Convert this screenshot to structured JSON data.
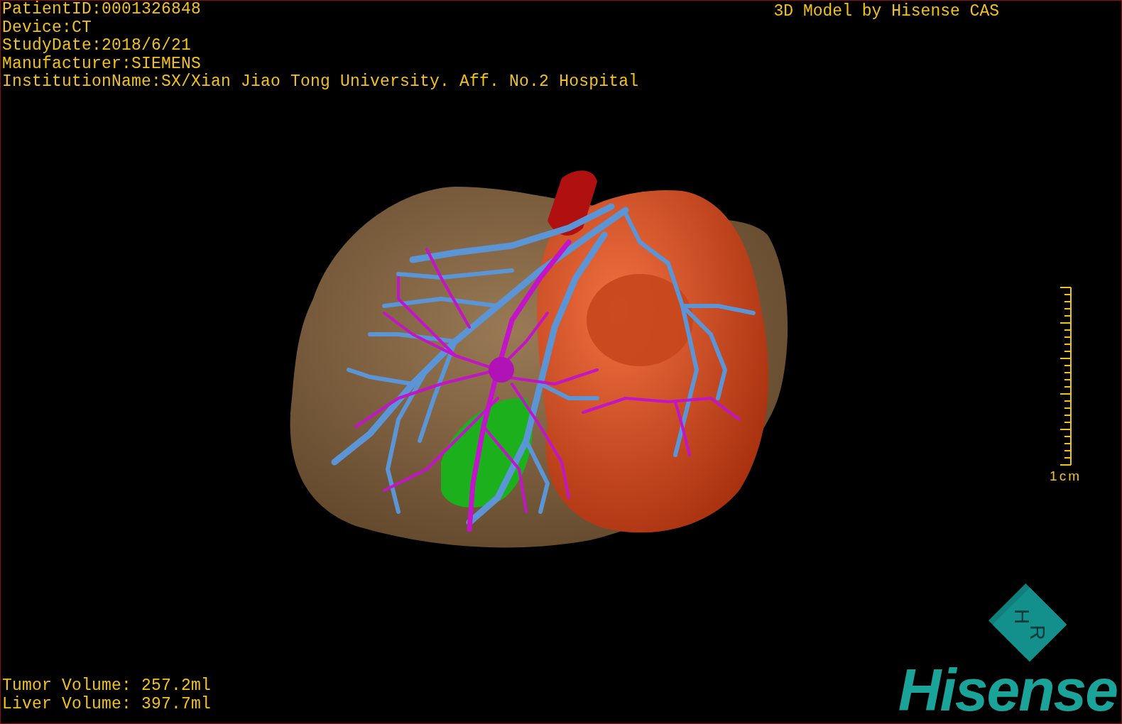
{
  "info_lines": [
    "PatientID:0001326848",
    "Device:CT",
    "StudyDate:2018/6/21",
    "Manufacturer:SIEMENS",
    "InstitutionName:SX/Xian Jiao Tong University. Aff. No.2 Hospital"
  ],
  "model_credit": "3D Model by Hisense CAS",
  "scale_bar": {
    "label": "1cm"
  },
  "volumes": [
    "Tumor Volume: 257.2ml",
    "Liver Volume: 397.7ml"
  ],
  "orientation_cube": {
    "labels": [
      "H",
      "R"
    ]
  },
  "logo": "Hisense"
}
